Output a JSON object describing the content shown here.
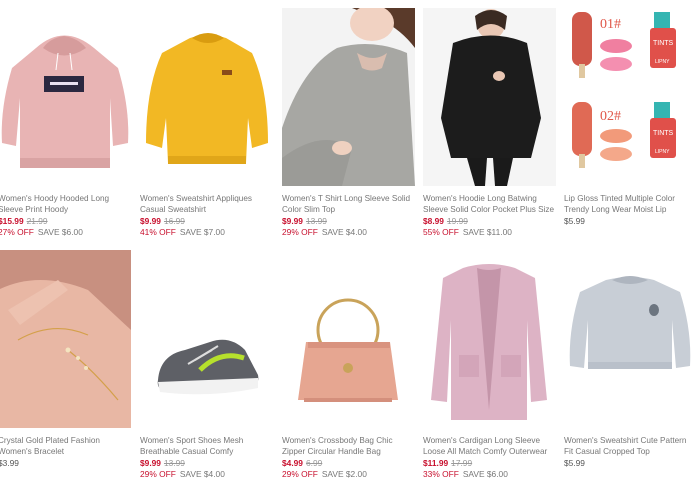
{
  "products": [
    {
      "title": "Women's Hoody Hooded Long Sleeve Print Hoody",
      "price": "$15.99",
      "orig": "21.99",
      "pct": "27% OFF",
      "save": "SAVE $6.00",
      "icon": "pink-hoodie-icon"
    },
    {
      "title": "Women's Sweatshirt Appliques Casual Sweatshirt",
      "price": "$9.99",
      "orig": "16.99",
      "pct": "41% OFF",
      "save": "SAVE $7.00",
      "icon": "yellow-sweatshirt-icon"
    },
    {
      "title": "Women's T Shirt Long Sleeve Solid Color Slim Top",
      "price": "$9.99",
      "orig": "13.99",
      "pct": "29% OFF",
      "save": "SAVE $4.00",
      "icon": "grey-shirt-model-icon"
    },
    {
      "title": "Women's Hoodie Long Batwing Sleeve Solid Color Pocket Plus Size",
      "price": "$8.99",
      "orig": "19.99",
      "pct": "55% OFF",
      "save": "SAVE $11.00",
      "icon": "black-hoodie-model-icon"
    },
    {
      "title": "Lip Gloss Tinted Multiple Color Trendy Long Wear Moist Lip Makeup",
      "price": "$5.99",
      "orig": "",
      "pct": "",
      "save": "",
      "icon": "lip-gloss-icon",
      "label_01": "01#",
      "label_02": "02#",
      "tint_text": "TINTS",
      "lipny_text": "LIPNY"
    },
    {
      "title": "Crystal Gold Plated Fashion Women's Bracelet",
      "price": "$3.99",
      "orig": "",
      "pct": "",
      "save": "",
      "icon": "hand-bracelet-icon"
    },
    {
      "title": "Women's Sport Shoes Mesh Breathable Casual Comfy Lightweight",
      "price": "$9.99",
      "orig": "13.99",
      "pct": "29% OFF",
      "save": "SAVE $4.00",
      "icon": "sport-shoe-icon"
    },
    {
      "title": "Women's Crossbody Bag Chic Zipper Circular Handle Bag",
      "price": "$4.99",
      "orig": "6.99",
      "pct": "29% OFF",
      "save": "SAVE $2.00",
      "icon": "pink-handbag-icon"
    },
    {
      "title": "Women's Cardigan Long Sleeve Loose All Match Comfy Outerwear",
      "price": "$11.99",
      "orig": "17.99",
      "pct": "33% OFF",
      "save": "SAVE $6.00",
      "icon": "pink-cardigan-icon"
    },
    {
      "title": "Women's Sweatshirt Cute Pattern Fit Casual Cropped Top",
      "price": "$5.99",
      "orig": "",
      "pct": "",
      "save": "",
      "icon": "grey-cropped-sweatshirt-icon"
    }
  ]
}
